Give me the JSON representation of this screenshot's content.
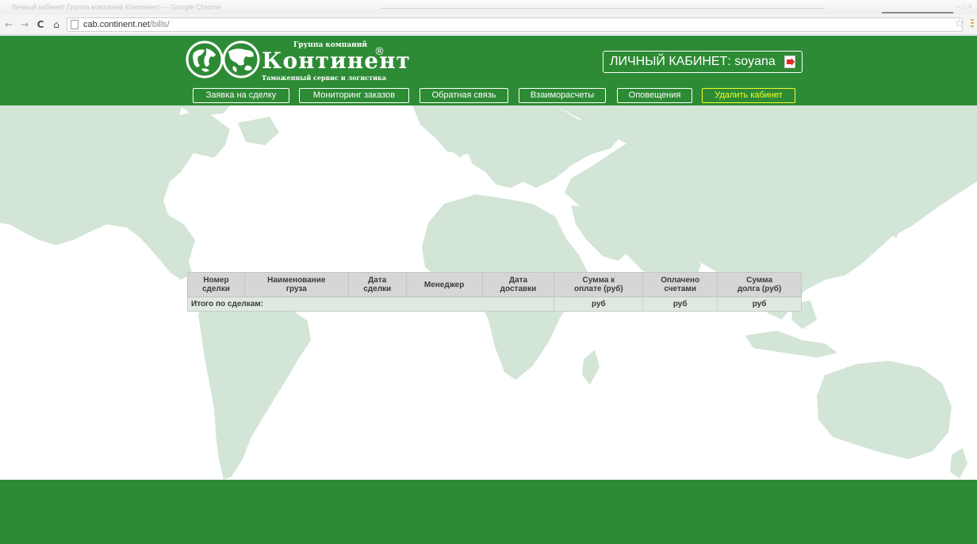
{
  "browser": {
    "tab_title": "Личный кабинет Группа компаний Континент — Google Chrome",
    "url_host": "cab.continent.net",
    "url_path": "/bills/",
    "window_controls": "– □ ×"
  },
  "header": {
    "logo_top": "Группа компаний",
    "logo_brand": "Континент",
    "logo_reg": "®",
    "logo_bottom": "Таможенный сервис и логистика",
    "cabinet_label": "ЛИЧНЫЙ КАБИНЕТ: soyana",
    "nav": [
      {
        "label": "Заявка на сделку"
      },
      {
        "label": "Мониторинг заказов"
      },
      {
        "label": "Обратная связь"
      },
      {
        "label": "Взаиморасчеты"
      },
      {
        "label": "Оповещения"
      },
      {
        "label": "Удалить кабинет"
      }
    ]
  },
  "table": {
    "columns": [
      "Номер\nсделки",
      "Наименование\nгруза",
      "Дата\nсделки",
      "Менеджер",
      "Дата\nдоставки",
      "Сумма к\nоплате (руб)",
      "Оплачено\nсчетами",
      "Сумма\nдолга (руб)"
    ],
    "total_label": "Итого по сделкам:",
    "totals": [
      "руб",
      "руб",
      "руб"
    ]
  },
  "colors": {
    "brand_green": "#2e8b35",
    "map_land": "#d3e5d6",
    "danger_button": "#f4ff2a"
  },
  "icons": [
    "back-icon",
    "forward-icon",
    "reload-icon",
    "home-icon",
    "page-icon",
    "star-icon",
    "globe-logo-icon",
    "exit-icon"
  ]
}
